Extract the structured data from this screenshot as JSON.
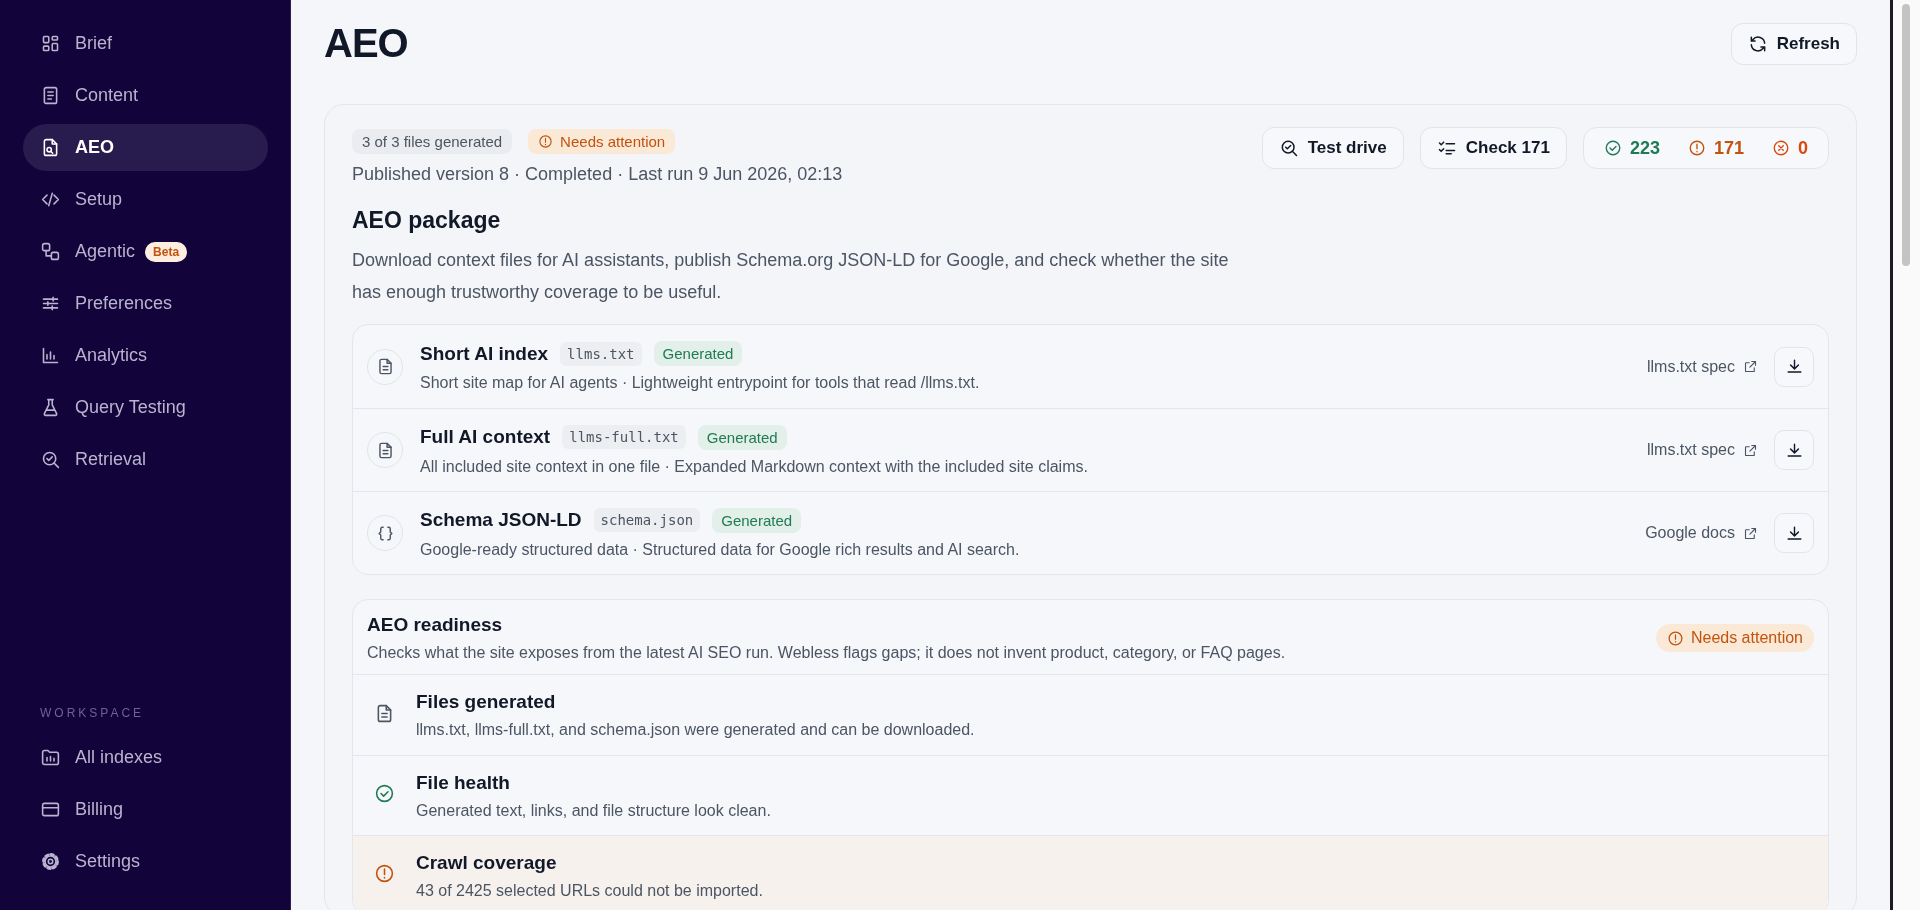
{
  "sidebar": {
    "items": [
      {
        "label": "Brief",
        "selected": false
      },
      {
        "label": "Content",
        "selected": false
      },
      {
        "label": "AEO",
        "selected": true
      },
      {
        "label": "Setup",
        "selected": false
      },
      {
        "label": "Agentic",
        "selected": false,
        "badge": "Beta"
      },
      {
        "label": "Preferences",
        "selected": false
      },
      {
        "label": "Analytics",
        "selected": false
      },
      {
        "label": "Query Testing",
        "selected": false
      },
      {
        "label": "Retrieval",
        "selected": false
      }
    ],
    "section_label": "WORKSPACE",
    "workspace_items": [
      {
        "label": "All indexes",
        "selected": false
      },
      {
        "label": "Billing",
        "selected": false
      },
      {
        "label": "Settings",
        "selected": false
      }
    ]
  },
  "page": {
    "title": "AEO",
    "refresh_button": "Refresh"
  },
  "package": {
    "files_chip": "3 of 3 files generated",
    "status": {
      "label": "Needs attention",
      "kind": "warning"
    },
    "meta": "Published version 8 · Completed · Last run 9 Jun 2026, 02:13",
    "title": "AEO package",
    "description": "Download context files for AI assistants, publish Schema.org JSON-LD for Google, and check whether the site has enough trustworthy coverage to be useful.",
    "actions": [
      {
        "label": "Test drive"
      },
      {
        "label": "Check 171"
      }
    ],
    "stats": [
      {
        "kind": "ok",
        "value": "223"
      },
      {
        "kind": "warning",
        "value": "171"
      },
      {
        "kind": "error",
        "value": "0"
      }
    ],
    "files": [
      {
        "kind": "text",
        "title": "Short AI index",
        "filename": "llms.txt",
        "badge": "Generated",
        "description": "Short site map for AI agents · Lightweight entrypoint for tools that read /llms.txt.",
        "link": "llms.txt spec"
      },
      {
        "kind": "text",
        "title": "Full AI context",
        "filename": "llms-full.txt",
        "badge": "Generated",
        "description": "All included site context in one file · Expanded Markdown context with the included site claims.",
        "link": "llms.txt spec"
      },
      {
        "kind": "json",
        "title": "Schema JSON-LD",
        "filename": "schema.json",
        "badge": "Generated",
        "description": "Google-ready structured data · Structured data for Google rich results and AI search.",
        "link": "Google docs"
      }
    ]
  },
  "readiness": {
    "title": "AEO readiness",
    "description": "Checks what the site exposes from the latest AI SEO run. Webless flags gaps; it does not invent product, category, or FAQ pages.",
    "status": {
      "label": "Needs attention",
      "kind": "warning"
    },
    "checks": [
      {
        "kind": "info",
        "title": "Files generated",
        "description": "llms.txt, llms-full.txt, and schema.json were generated and can be downloaded."
      },
      {
        "kind": "ok",
        "title": "File health",
        "description": "Generated text, links, and file structure look clean."
      },
      {
        "kind": "warning",
        "title": "Crawl coverage",
        "description": "43 of 2425 selected URLs could not be imported."
      }
    ]
  }
}
